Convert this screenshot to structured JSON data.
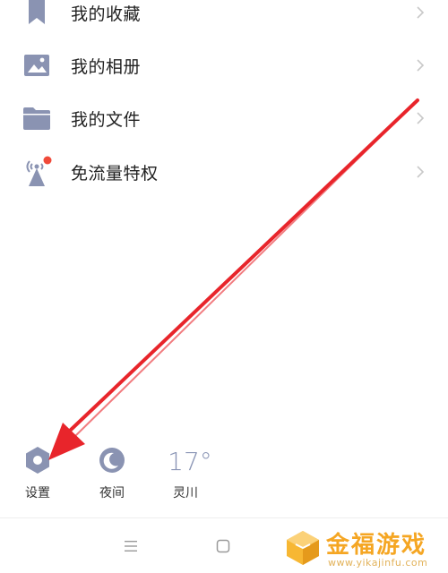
{
  "menu": {
    "items": [
      {
        "label": "我的收藏",
        "icon": "bookmark-icon"
      },
      {
        "label": "我的相册",
        "icon": "photo-album-icon"
      },
      {
        "label": "我的文件",
        "icon": "folder-icon"
      },
      {
        "label": "免流量特权",
        "icon": "signal-tower-icon"
      }
    ]
  },
  "bottom_tools": {
    "settings_label": "设置",
    "night_label": "夜间",
    "weather_temp": "17°",
    "weather_city": "灵川"
  },
  "navbar": {
    "menu_glyph": "≡",
    "home_glyph": "▢"
  },
  "watermark": {
    "text": "金福游戏",
    "url": "www.yikajinfu.com"
  },
  "colors": {
    "icon": "#8a93b2",
    "text": "#222222",
    "chevron": "#c8c8c8",
    "badge": "#f04a3a",
    "arrow": "#e8252b",
    "watermark": "#f5a623"
  }
}
